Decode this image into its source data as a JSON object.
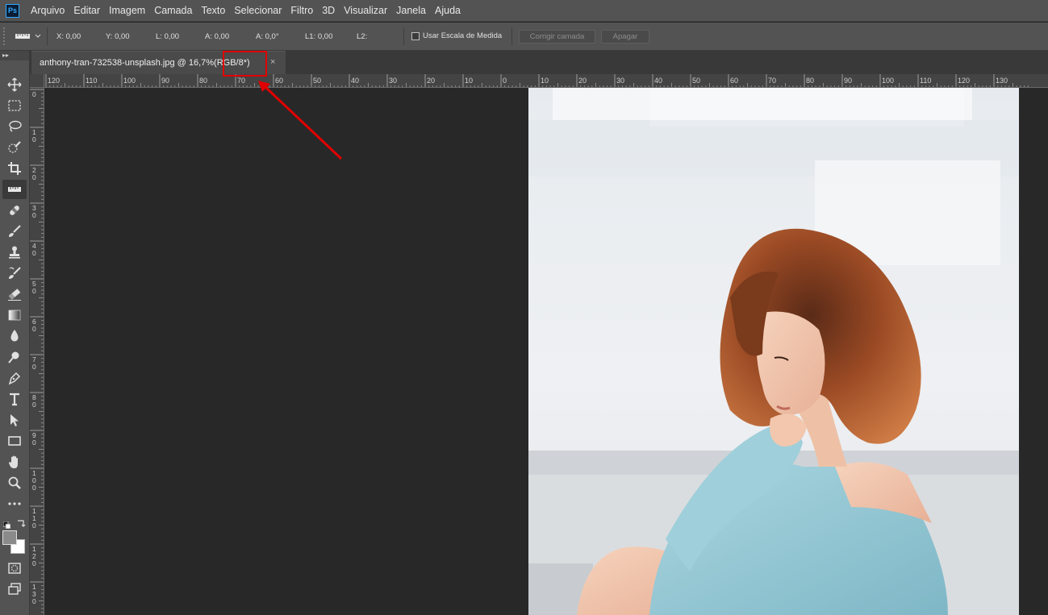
{
  "app": {
    "logo_text": "Ps"
  },
  "menu": [
    "Arquivo",
    "Editar",
    "Imagem",
    "Camada",
    "Texto",
    "Selecionar",
    "Filtro",
    "3D",
    "Visualizar",
    "Janela",
    "Ajuda"
  ],
  "options": {
    "x_label": "X:",
    "x_value": "0,00",
    "y_label": "Y:",
    "y_value": "0,00",
    "l_label": "L:",
    "l_value": "0,00",
    "a_label": "A:",
    "a_value": "0,00",
    "angle_label": "A:",
    "angle_value": "0,0°",
    "l1_label": "L1:",
    "l1_value": "0,00",
    "l2_label": "L2:",
    "l2_value": "",
    "use_scale_label": "Usar Escala de Medida",
    "use_scale_checked": false,
    "straighten_label": "Corrigir camada",
    "clear_label": "Apagar"
  },
  "document": {
    "tab_name": "anthony-tran-732538-unsplash.jpg @ 16,7% ",
    "tab_mode": "(RGB/8*)",
    "close_glyph": "×"
  },
  "ruler_h_labels": [
    "120",
    "110",
    "100",
    "90",
    "80",
    "70",
    "60",
    "50",
    "40",
    "30",
    "20",
    "10",
    "0",
    "10",
    "20",
    "30",
    "40",
    "50",
    "60",
    "70",
    "80",
    "90",
    "100",
    "110",
    "120",
    "130"
  ],
  "ruler_v_labels": [
    "0",
    "1\n0",
    "2\n0",
    "3\n0",
    "4\n0",
    "5\n0",
    "6\n0",
    "7\n0",
    "8\n0",
    "9\n0",
    "1\n0\n0",
    "1\n1\n0",
    "1\n2\n0",
    "1\n3\n0"
  ],
  "tools": [
    {
      "name": "move-tool-icon"
    },
    {
      "name": "marquee-tool-icon"
    },
    {
      "name": "lasso-tool-icon"
    },
    {
      "name": "quick-selection-tool-icon"
    },
    {
      "name": "crop-tool-icon"
    },
    {
      "name": "ruler-tool-icon",
      "active": true
    },
    {
      "name": "healing-brush-tool-icon"
    },
    {
      "name": "brush-tool-icon"
    },
    {
      "name": "clone-stamp-tool-icon"
    },
    {
      "name": "history-brush-tool-icon"
    },
    {
      "name": "eraser-tool-icon"
    },
    {
      "name": "gradient-tool-icon"
    },
    {
      "name": "blur-tool-icon"
    },
    {
      "name": "dodge-tool-icon"
    },
    {
      "name": "pen-tool-icon"
    },
    {
      "name": "type-tool-icon"
    },
    {
      "name": "path-selection-tool-icon"
    },
    {
      "name": "rectangle-tool-icon"
    },
    {
      "name": "hand-tool-icon"
    },
    {
      "name": "zoom-tool-icon"
    },
    {
      "name": "more-tools-icon"
    }
  ],
  "colors": {
    "foreground": "#8a8a8a",
    "background": "#ffffff",
    "annotation": "#e10000"
  }
}
